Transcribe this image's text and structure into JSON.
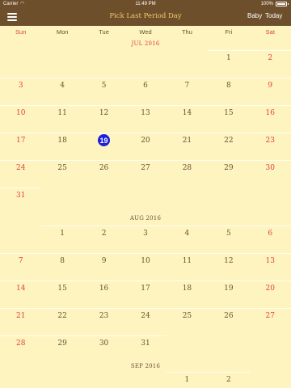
{
  "status_bar": {
    "carrier": "Carrier",
    "wifi_icon": "wifi-icon",
    "time": "11:49 PM",
    "battery": "100%"
  },
  "nav": {
    "menu_icon": "hamburger-menu-icon",
    "title": "Pick Last Period Day",
    "baby_label": "Baby",
    "today_label": "Today"
  },
  "weekdays": [
    "Sun",
    "Mon",
    "Tue",
    "Wed",
    "Thu",
    "Fri",
    "Sat"
  ],
  "months": [
    {
      "title": "JUL 2016",
      "first_weekday": 5,
      "days": 31,
      "highlight_title": true
    },
    {
      "title": "AUG 2016",
      "first_weekday": 1,
      "days": 31,
      "highlight_title": false
    },
    {
      "title": "SEP 2016",
      "first_weekday": 4,
      "days_visible": 2,
      "highlight_title": false
    }
  ],
  "selected": {
    "month": "JUL 2016",
    "day": "19"
  },
  "colors": {
    "nav_bg": "#6e4f2c",
    "title": "#f4c96b",
    "weekend": "#e0413c",
    "text": "#6b4e32",
    "background": "#fef4c0",
    "selected": "#1e1ede"
  }
}
